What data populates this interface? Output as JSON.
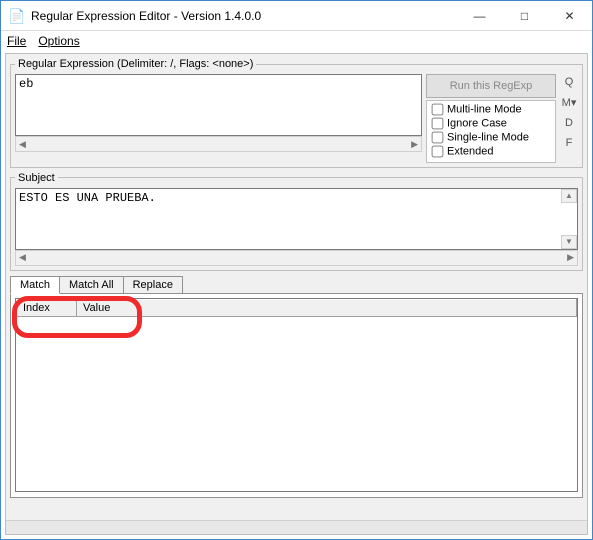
{
  "window": {
    "title": "Regular Expression Editor - Version 1.4.0.0"
  },
  "menu": {
    "file": "File",
    "options": "Options"
  },
  "regex_group": {
    "legend": "Regular Expression (Delimiter: /, Flags: <none>)",
    "value": "eb",
    "run_label": "Run this RegExp",
    "flags": {
      "multiline": "Multi-line Mode",
      "ignorecase": "Ignore Case",
      "singleline": "Single-line Mode",
      "extended": "Extended"
    }
  },
  "side": {
    "q": "Q",
    "m": "M▾",
    "d": "D",
    "f": "F"
  },
  "subject_group": {
    "legend": "Subject",
    "value": "ESTO ES UNA PRUEBA."
  },
  "tabs": {
    "match": "Match",
    "match_all": "Match All",
    "replace": "Replace"
  },
  "columns": {
    "index": "Index",
    "value": "Value"
  }
}
